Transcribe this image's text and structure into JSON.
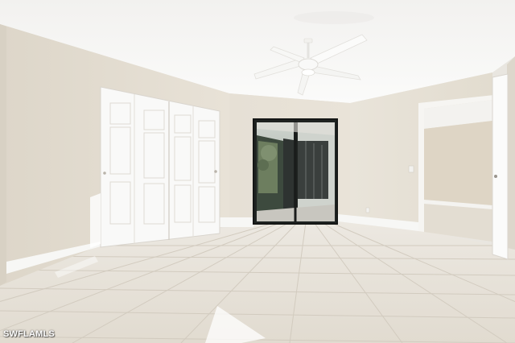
{
  "watermark": "SWFLAMLS",
  "colors": {
    "ceiling": "#f6f5f3",
    "wall": "#e7e1d6",
    "wall_shadow": "#dcd5c8",
    "floor": "#e6e1d8",
    "grout": "#cfc8bc",
    "baseboard": "#f7f7f5",
    "door_white": "#fbfbfa",
    "glass_dark": "#2a2d2c"
  },
  "icons": [
    "ceiling-fan-icon"
  ]
}
